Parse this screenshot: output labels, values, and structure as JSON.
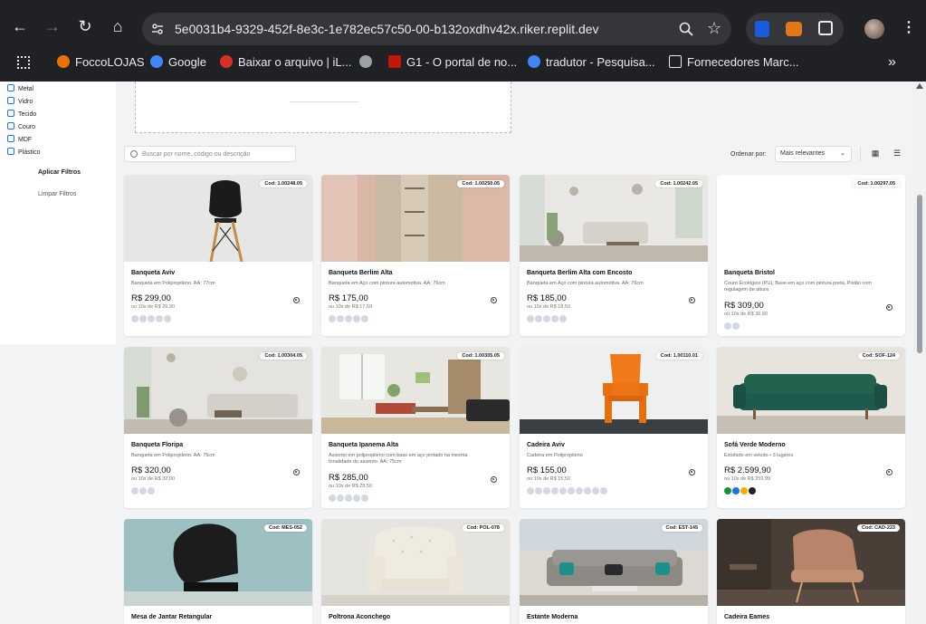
{
  "browser": {
    "url": "5e0031b4-9329-452f-8e3c-1e782ec57c50-00-b132oxdhv42x.riker.replit.dev",
    "bookmarks": [
      {
        "label": "FoccoLOJAS",
        "icon": "foccolojas-icon",
        "color": "#e8710a"
      },
      {
        "label": "Google",
        "icon": "google-icon",
        "color": "#4285f4"
      },
      {
        "label": "Baixar o arquivo | iL...",
        "icon": "heart-icon",
        "color": "#d93025"
      },
      {
        "label": "",
        "icon": "globe-icon",
        "color": "#9aa0a6"
      },
      {
        "label": "G1 - O portal de no...",
        "icon": "g1-icon",
        "color": "#c4170c"
      },
      {
        "label": "tradutor - Pesquisa...",
        "icon": "google-icon",
        "color": "#4285f4"
      },
      {
        "label": "Fornecedores Marc...",
        "icon": "folder-icon",
        "color": "#e8eaed"
      }
    ]
  },
  "sidebar": {
    "materials": [
      "Metal",
      "Vidro",
      "Tecido",
      "Couro",
      "MDF",
      "Plástico"
    ],
    "apply_label": "Aplicar Filtros",
    "clear_label": "Limpar Filtros"
  },
  "toolbar": {
    "search_placeholder": "Buscar por nome, código ou descrição",
    "order_label": "Ordenar por:",
    "order_value": "Mais relevantes"
  },
  "products": [
    {
      "code": "Cod: 1.00248.05",
      "name": "Banqueta Aviv",
      "desc": "Banqueta em Polipropileno. AA: 77cm",
      "price": "R$ 299,00",
      "installments": "ou 10x de R$ 29,90",
      "swatches": 5
    },
    {
      "code": "Cod: 1.00250.05",
      "name": "Banqueta Berlim Alta",
      "desc": "Banqueta em Aço com pintura automotiva. AA: 76cm",
      "price": "R$ 175,00",
      "installments": "ou 10x de R$ 17,50",
      "swatches": 5
    },
    {
      "code": "Cod: 1.00242.05",
      "name": "Banqueta Berlim Alta com Encosto",
      "desc": "Banqueta em Aço com pintura automotiva. AA: 76cm",
      "price": "R$ 185,00",
      "installments": "ou 10x de R$ 18,50",
      "swatches": 5
    },
    {
      "code": "Cod: 1.00297.05",
      "name": "Banqueta Bristol",
      "desc": "Couro Ecológico (PU), Base em aço com pintura preta, Pistão com regulagem de altura",
      "price": "R$ 309,00",
      "installments": "ou 10x de R$ 30,90",
      "swatches": 2
    },
    {
      "code": "Cod: 1.00304.05",
      "name": "Banqueta Floripa",
      "desc": "Banqueta em Polipropileno. AA: 75cm",
      "price": "R$ 320,00",
      "installments": "ou 10x de R$ 32,00",
      "swatches": 3
    },
    {
      "code": "Cod: 1.00305.05",
      "name": "Banqueta Ipanema Alta",
      "desc": "Assento em polipropileno com base em aço pintado na mesma tonalidade do assento. AA: 75cm",
      "price": "R$ 285,00",
      "installments": "ou 10x de R$ 28,50",
      "swatches": 5
    },
    {
      "code": "Cod: 1.00110.01",
      "name": "Cadeira Aviv",
      "desc": "Cadeira em Polipropileno",
      "price": "R$ 155,00",
      "installments": "ou 10x de R$ 15,50",
      "swatches": 10
    },
    {
      "code": "Cod: SOF-124",
      "name": "Sofá Verde Moderno",
      "desc": "Estofado em veludo • 3 lugares",
      "price": "R$ 2.599,90",
      "installments": "ou 10x de R$ 259,99",
      "swatches": 4,
      "swatch_colors": [
        "#1e8e3e",
        "#1a73e8",
        "#f9ab00",
        "#202124"
      ]
    },
    {
      "code": "Cod: MES-052",
      "name": "Mesa de Jantar Retangular",
      "desc": "",
      "price": "",
      "installments": "",
      "swatches": 0
    },
    {
      "code": "Cod: POL-078",
      "name": "Poltrona Aconchego",
      "desc": "",
      "price": "",
      "installments": "",
      "swatches": 0
    },
    {
      "code": "Cod: EST-145",
      "name": "Estante Moderna",
      "desc": "",
      "price": "",
      "installments": "",
      "swatches": 0
    },
    {
      "code": "Cod: CAD-223",
      "name": "Cadeira Eames",
      "desc": "",
      "price": "",
      "installments": "",
      "swatches": 0
    }
  ]
}
